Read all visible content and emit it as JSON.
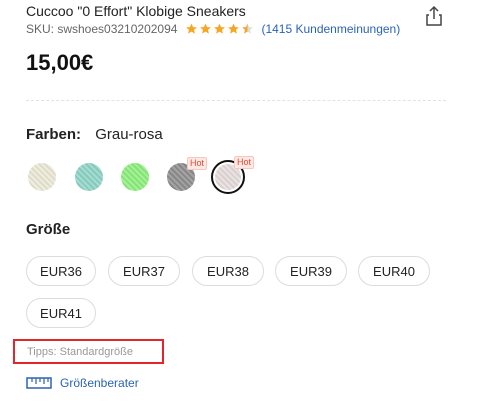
{
  "product": {
    "title": "Cuccoo \"0 Effort\" Klobige Sneakers",
    "sku": "SKU: swshoes03210202094",
    "rating": 4.5,
    "reviews": "(1415 Kundenmeinungen)",
    "price": "15,00€"
  },
  "colors": {
    "label": "Farben:",
    "selected": "Grau-rosa",
    "swatches": [
      {
        "name": "beige",
        "color": "#ece9d6",
        "hot": false
      },
      {
        "name": "mint",
        "color": "#8fd6c8",
        "hot": false
      },
      {
        "name": "green",
        "color": "#8ef07e",
        "hot": false
      },
      {
        "name": "grey",
        "color": "#8f8f8f",
        "hot": true,
        "badge": "Hot"
      },
      {
        "name": "grey-pink",
        "color": "#e6dcdc",
        "hot": true,
        "badge": "Hot",
        "selected": true
      }
    ]
  },
  "size": {
    "label": "Größe",
    "options": [
      "EUR36",
      "EUR37",
      "EUR38",
      "EUR39",
      "EUR40",
      "EUR41"
    ],
    "tip": "Tipps: Standardgröße",
    "guide": "Größenberater"
  },
  "accent": "#2a63b9",
  "star_color": "#f5a623",
  "highlight_color": "#e3262b"
}
